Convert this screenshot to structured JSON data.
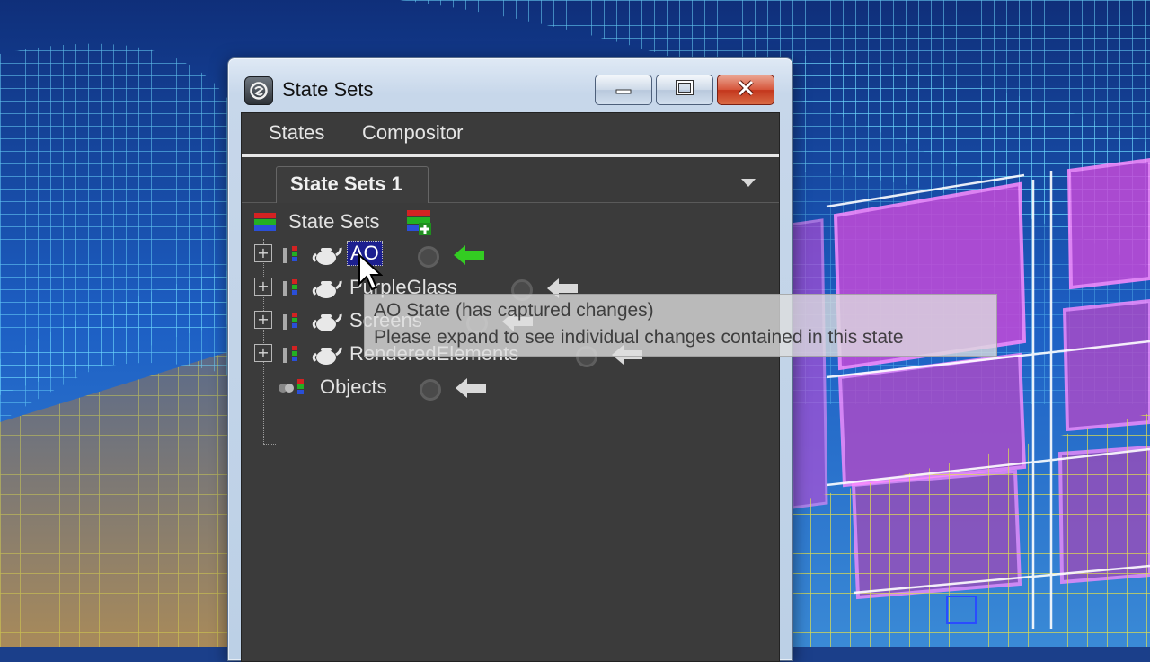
{
  "window": {
    "title": "State Sets"
  },
  "menubar": {
    "items": [
      {
        "label": "States"
      },
      {
        "label": "Compositor"
      }
    ]
  },
  "tabs": {
    "active_label": "State Sets 1"
  },
  "tree": {
    "root_label": "State Sets",
    "items": [
      {
        "label": "AO",
        "selected": true,
        "active": true
      },
      {
        "label": "PurpleGlass",
        "selected": false,
        "active": false
      },
      {
        "label": "Screens",
        "selected": false,
        "active": false
      },
      {
        "label": "RenderedElements",
        "selected": false,
        "active": false
      }
    ],
    "objects_label": "Objects"
  },
  "tooltip": {
    "title": "AO State (has captured changes)",
    "body": "Please expand to see individual changes contained in this state"
  },
  "colors": {
    "panel_bg": "#3b3b3b",
    "selection": "#1c1f8f",
    "active_arrow": "#33cc22",
    "inactive_arrow": "#d9d9d9",
    "wire_cyan": "#5fd7ff",
    "wire_magenta": "#e04fe0",
    "wire_yellow": "#e6e04a"
  },
  "icons": {
    "app": "3dsmax-logo-icon",
    "minimize": "minimize-icon",
    "maximize": "maximize-icon",
    "close": "close-icon",
    "state_sets": "state-sets-icon",
    "add_state": "add-state-icon",
    "teapot": "teapot-icon",
    "active": "active-state-arrow-icon"
  }
}
